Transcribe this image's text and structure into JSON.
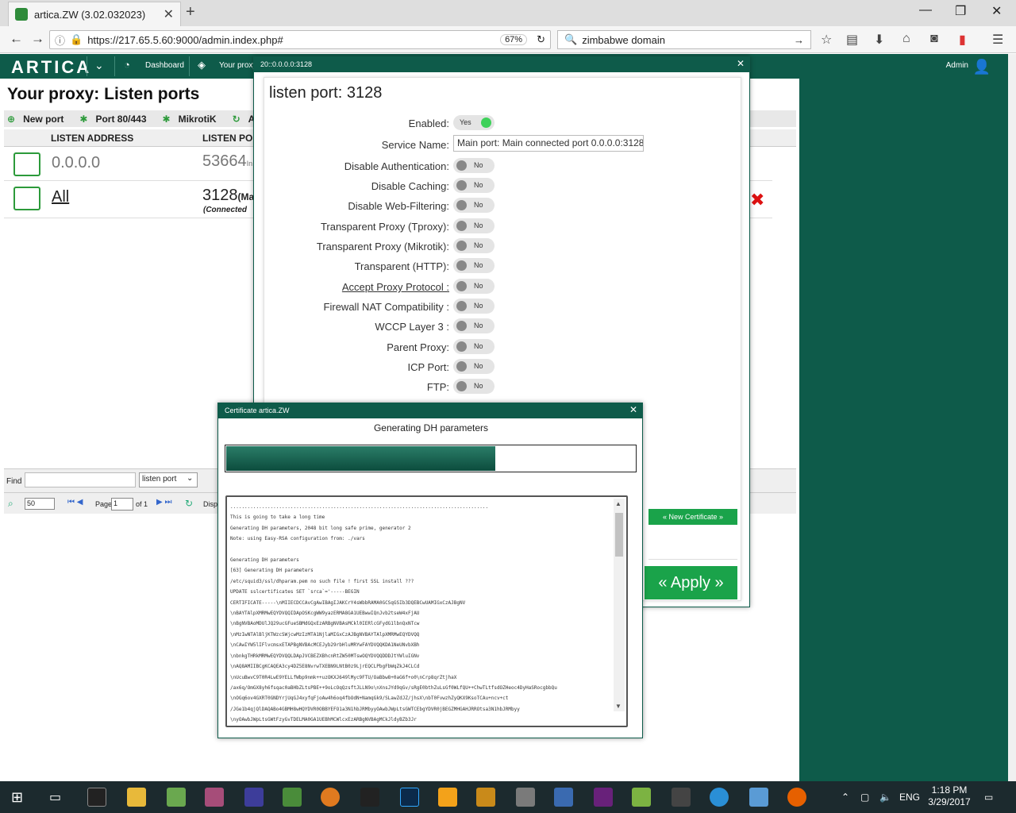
{
  "browser": {
    "tab_title": "artica.ZW (3.02.032023)",
    "url": "https://217.65.5.60:9000/admin.index.php#",
    "zoom": "67%",
    "search_query": "zimbabwe domain"
  },
  "header": {
    "logo": "ARTICA",
    "links": [
      "Dashboard",
      "Your proxy"
    ],
    "admin": "Admin"
  },
  "page": {
    "title": "Your proxy: Listen ports",
    "toolbar": [
      "New port",
      "Port 80/443",
      "MikrotiK",
      "Apply"
    ],
    "columns": [
      "LISTEN ADDRESS",
      "LISTEN PO"
    ],
    "rows": [
      {
        "address": "0.0.0.0",
        "port": "53664",
        "port_suffix": "In",
        "sub": ""
      },
      {
        "address": "All",
        "port": "3128",
        "port_suffix": "(Ma",
        "sub": "(Connected"
      }
    ],
    "find_label": "Find",
    "find_select": "listen port",
    "pager": {
      "per_page": "50",
      "page_label": "Page",
      "page_value": "1",
      "of_label": "of 1",
      "display": "Displ"
    }
  },
  "listen_dialog": {
    "title": "20::0.0.0.0:3128",
    "heading": "listen port: 3128",
    "enabled_label": "Enabled:",
    "enabled_value": "Yes",
    "service_label": "Service Name:",
    "service_value": "Main port: Main connected port 0.0.0.0:3128",
    "options": [
      {
        "label": "Disable Authentication:",
        "value": "No"
      },
      {
        "label": "Disable Caching:",
        "value": "No"
      },
      {
        "label": "Disable Web-Filtering:",
        "value": "No"
      },
      {
        "label": "Transparent Proxy (Tproxy):",
        "value": "No"
      },
      {
        "label": "Transparent Proxy (Mikrotik):",
        "value": "No"
      },
      {
        "label": "Transparent (HTTP):",
        "value": "No"
      },
      {
        "label": "Accept Proxy Protocol :",
        "value": "No"
      },
      {
        "label": "Firewall NAT Compatibility :",
        "value": "No"
      },
      {
        "label": "WCCP Layer 3 :",
        "value": "No"
      },
      {
        "label": "Parent Proxy:",
        "value": "No"
      },
      {
        "label": "ICP Port:",
        "value": "No"
      },
      {
        "label": "FTP:",
        "value": "No"
      }
    ],
    "new_certificate": "« New Certificate »",
    "apply": "« Apply »"
  },
  "cert_dialog": {
    "title": "Certificate artica.ZW",
    "status": "Generating DH parameters",
    "progress": 0.655,
    "log": [
      "..........................................................................................",
      "This is going to take a long time",
      "Generating DH parameters, 2048 bit long safe prime, generator 2",
      "Note: using Easy-RSA configuration from: ./vars",
      "",
      "Generating DH parameters",
      "[63] Generating DH parameters",
      "/etc/squid3/ssl/dhparam.pem no such file ! first SSL install ???",
      "UPDATE sslcertificates SET `srca`='-----BEGIN",
      "CERTIFICATE-----\\nMIIECDCCAvCgAwIBAgIJAKCrY4sWbbRAMA0GCSqGSIb3DQEBCwUAMIGxCzAJBgNV",
      "\\nBAYTAlpXMRMwEQYDVQQIDApOSKcgWW9yazERMA8GA1UEBwwIQnJvb2tseW4xFjAU",
      "\\nBgNVBAoMDUlJQ29ucGFueSBMdGQxEzARBgNVBAsMCkl0IERlcGFydG1lbnQxNTcw",
      "\\nMzIwNTAlBljKTWzcSWjcwMzIzMTA1NjlaMIGxCzAJBgNVBAYTAlpXMRMwEQYDVQQ",
      "\\nCAwIYW5lIFlvcmsxETAPBgNVBAcMCEJyb29rbHluMRYwFAYDVQQKDA1NeUNvbXBh",
      "\\nbnkgTHRkMRMwEQYDVQQLDApJVCBEZXBhcnRtZW50MTswOQYDVQQDDDJtYWluIGNv",
      "\\nAQ8AMIIBCgKCAQEA3cy4DZ5E8NvrwTXEBN9LNtB0z9LjrEQCLPbgFbWqZkJ4CLCd",
      "\\nUcuBwvC9T0R4LwE9YELLfWbp9nmk++uzOKXJ649lMyc9FTU/OaBbw8+0aG6f+o0\\nCrp8qrZtjhaX",
      "/ax6q/OmGX8yh6fsqac0aBHbZLtsPBE++9oLcOqQzsftJLLN9o\\nXnsJYd9qGv/sRgE0bthZuLsGf0WLfQU++ChwTLtfsdOZHeoc4DyHaSRocgbbQu",
      "\\nOGq6ov4GXRT0GNDYrjUqGJ4xyfqFjoAw4h6oq4fbOdN+NamqGk9/SLawZdJZ/jhsX\\nbT0FvwzhZyQKX9KsoTCAu+ncv+ct",
      "/JGe1b4qjQlDAQABo4GBMH8wHQYDVR0OBBYEFO1a3N1hbJRMbyyOAwbJWpLtsGWTCEbgYDVR0jBEGZMHGAHJRROtsa3N1hbJRMbyy",
      "\\nyOAwbJWpLtsGWtFzyGvTDELMA0GA1UEBhMCWlcxEzARBgNVBAgMCkJldyBZb3Jr"
    ]
  },
  "taskbar": {
    "lang": "ENG",
    "time": "1:18 PM",
    "date": "3/29/2017"
  }
}
